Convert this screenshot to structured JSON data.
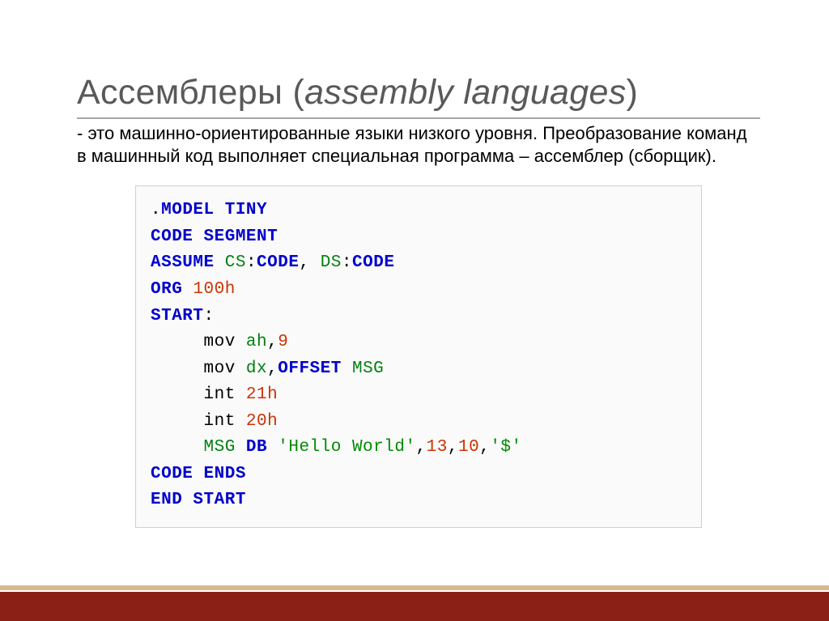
{
  "title_main": "Ассемблеры ",
  "title_paren_open": "(",
  "title_italic": "assembly languages",
  "title_paren_close": ")",
  "description": "- это машинно-ориентированные языки низкого уровня. Преобразование команд в машинный код выполняет специальная программа – ассемблер (сборщик).",
  "code": {
    "l1_dot": ".",
    "l1_model": "MODEL TINY",
    "l2_code": "CODE",
    "l2_segment": " SEGMENT",
    "l3_assume": "ASSUME ",
    "l3_cs": "CS",
    "l3_colon1": ":",
    "l3_code1": "CODE",
    "l3_comma": ", ",
    "l3_ds": "DS",
    "l3_colon2": ":",
    "l3_code2": "CODE",
    "l4_org": "ORG ",
    "l4_100h": "100h",
    "l5_start": "START",
    "l5_colon": ":",
    "l6_mov": "     mov ",
    "l6_ah": "ah",
    "l6_comma": ",",
    "l6_9": "9",
    "l7_mov": "     mov ",
    "l7_dx": "dx",
    "l7_comma": ",",
    "l7_offset": "OFFSET ",
    "l7_msg": "MSG",
    "l8_int": "     int ",
    "l8_21h": "21h",
    "l9_int": "     int ",
    "l9_20h": "20h",
    "l10_msg": "     MSG ",
    "l10_db": "DB ",
    "l10_str": "'Hello World'",
    "l10_comma1": ",",
    "l10_13": "13",
    "l10_comma2": ",",
    "l10_10": "10",
    "l10_comma3": ",",
    "l10_dollar": "'$'",
    "l11_code": "CODE",
    "l11_ends": " ENDS",
    "l12_end": "END ",
    "l12_start": "START"
  }
}
